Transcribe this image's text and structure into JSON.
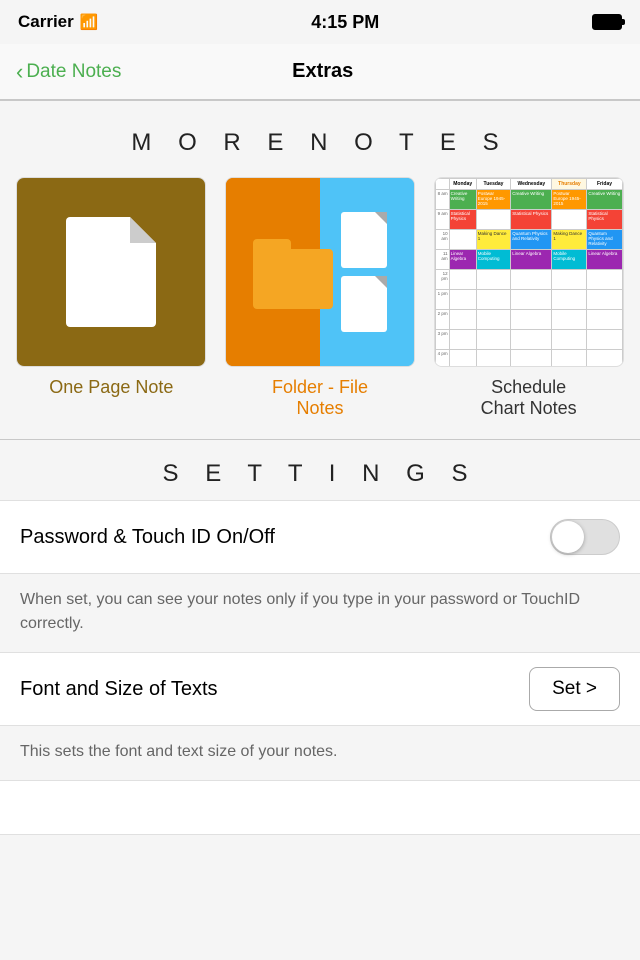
{
  "status": {
    "carrier": "Carrier",
    "time": "4:15 PM"
  },
  "nav": {
    "back_label": "Date Notes",
    "title": "Extras"
  },
  "more_notes": {
    "section_title": "M O R E   N O T E S",
    "cards": [
      {
        "id": "one-page-note",
        "label": "One Page Note",
        "label_color": "#8B6914"
      },
      {
        "id": "folder-file-notes",
        "label": "Folder - File\nNotes",
        "label_color": "#e67e00"
      },
      {
        "id": "schedule-chart-notes",
        "label": "Schedule\nChart Notes",
        "label_color": "#333"
      }
    ]
  },
  "settings": {
    "section_title": "S E T T I N G S",
    "password_label": "Password & Touch ID On/Off",
    "password_description": "When set, you can see your notes only if you type in your password or TouchID correctly.",
    "password_toggle": false,
    "font_label": "Font and Size of Texts",
    "font_button": "Set >",
    "font_description": "This sets the font and text size of your notes."
  },
  "schedule_data": {
    "headers": [
      "",
      "Monday",
      "Tuesday",
      "Wednesday",
      "Thursday",
      "Friday"
    ],
    "times": [
      "8 am",
      "9 am",
      "10 am",
      "11 am",
      "12 pm",
      "1 pm",
      "2 pm",
      "3 pm",
      "4 pm"
    ],
    "cells": {
      "r0": [
        "Creative Writing",
        "Postwar Europe 1945-2015",
        "Creative Writing",
        "Postwar Europe 1945-2015",
        "Creative Writing"
      ],
      "r1": [
        "Statistical Physics",
        "",
        "Statistical Physics",
        "",
        "Statistical Physics"
      ],
      "r2": [
        "",
        "Making Dance 1",
        "Quantum Physics and Relativity",
        "Making Dance 1",
        "Quantum Physics and Relativity"
      ],
      "r3": [
        "Linear Algebra",
        "Mobile Computing",
        "Linear Algebra",
        "Mobile Computing",
        "Linear Algebra"
      ]
    }
  }
}
